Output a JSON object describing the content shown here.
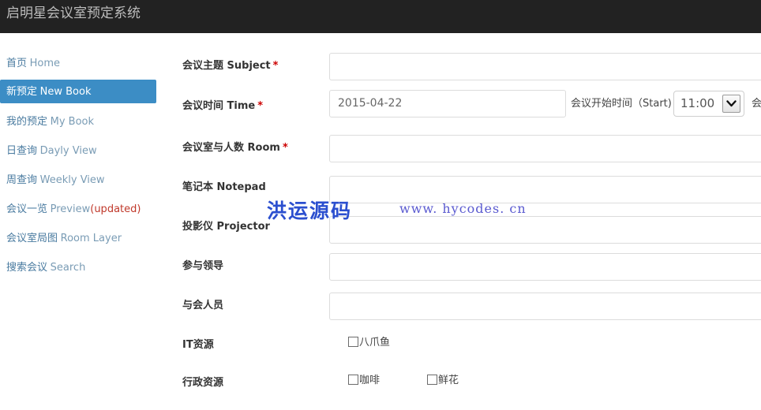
{
  "header": {
    "title": "启明星会议室预定系统"
  },
  "sidebar": {
    "items": [
      {
        "cn": "首页",
        "en": "Home",
        "active": false,
        "badge": ""
      },
      {
        "cn": "新预定",
        "en": "New Book",
        "active": true,
        "badge": ""
      },
      {
        "cn": "我的预定",
        "en": "My Book",
        "active": false,
        "badge": ""
      },
      {
        "cn": "日查询",
        "en": "Dayly View",
        "active": false,
        "badge": ""
      },
      {
        "cn": "周查询",
        "en": "Weekly View",
        "active": false,
        "badge": ""
      },
      {
        "cn": "会议一览",
        "en": "Preview",
        "active": false,
        "badge": "(updated)"
      },
      {
        "cn": "会议室局图",
        "en": "Room Layer",
        "active": false,
        "badge": ""
      },
      {
        "cn": "搜索会议",
        "en": "Search",
        "active": false,
        "badge": ""
      }
    ]
  },
  "form": {
    "rows": {
      "subject": {
        "label": "会议主题 Subject",
        "required": "*",
        "value": ""
      },
      "time": {
        "label": "会议时间 Time",
        "required": "*",
        "date_value": "2015-04-22",
        "start_label": "会议开始时间（Start)",
        "start_value": "11:00",
        "end_label_partial": "会"
      },
      "room": {
        "label": "会议室与人数 Room",
        "required": "*",
        "value": ""
      },
      "notepad": {
        "label": "笔记本 Notepad",
        "required": "",
        "value": ""
      },
      "projector": {
        "label": "投影仪 Projector",
        "required": "",
        "value": ""
      },
      "leaders": {
        "label": "参与领导",
        "required": "",
        "value": ""
      },
      "attendees": {
        "label": "与会人员",
        "required": "",
        "value": ""
      },
      "it_resource": {
        "label": "IT资源",
        "options": [
          {
            "label": "八爪鱼",
            "checked": false
          }
        ]
      },
      "admin_resource": {
        "label": "行政资源",
        "options": [
          {
            "label": "咖啡",
            "checked": false
          },
          {
            "label": "鲜花",
            "checked": false
          }
        ]
      }
    }
  },
  "watermark": {
    "brand": "洪运源码",
    "url": "www. hycodes. cn"
  },
  "colors": {
    "topbar_bg": "#222222",
    "accent_blue": "#3c8dc5",
    "nav_text": "#4a7ba0",
    "badge_red": "#c0392b",
    "required_red": "#cc0000",
    "watermark_blue": "#2b4fcf"
  }
}
